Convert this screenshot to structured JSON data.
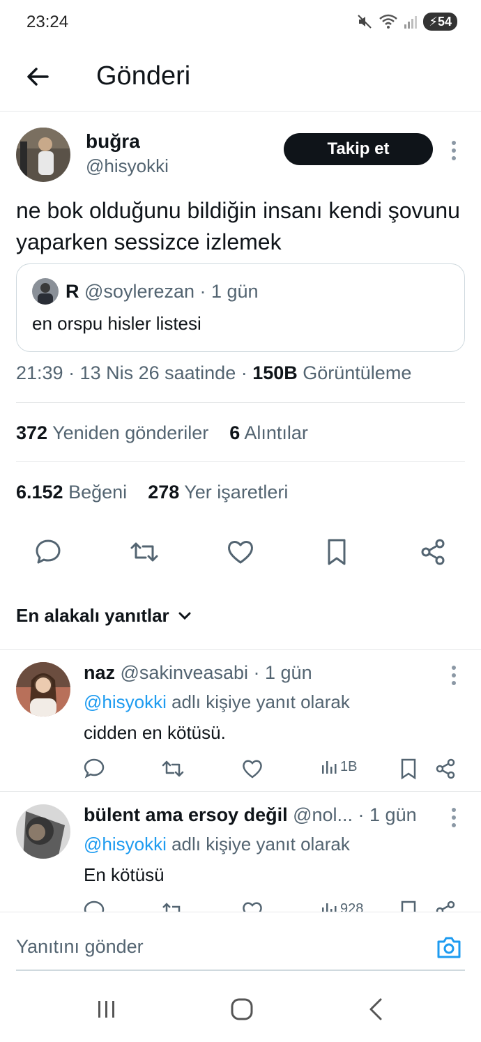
{
  "status": {
    "time": "23:24",
    "battery": "54"
  },
  "header": {
    "title": "Gönderi"
  },
  "author": {
    "name": "buğra",
    "handle": "@hisyokki",
    "follow_label": "Takip et"
  },
  "tweet": {
    "text": "ne bok olduğunu bildiğin insanı kendi şovunu yaparken sessizce izlemek",
    "quote": {
      "name": "R",
      "handle_time": "@soylerezan · 1 gün",
      "text": "en orspu hisler listesi"
    },
    "meta": {
      "time_date": "21:39 · 13 Nis 26 saatinde · ",
      "views_count": "150B",
      "views_label": " Görüntüleme"
    }
  },
  "stats": {
    "reposts_count": "372",
    "reposts_label": "Yeniden gönderiler",
    "quotes_count": "6",
    "quotes_label": "Alıntılar",
    "likes_count": "6.152",
    "likes_label": "Beğeni",
    "bookmarks_count": "278",
    "bookmarks_label": "Yer işaretleri"
  },
  "sort": {
    "label": "En alakalı yanıtlar"
  },
  "replies": [
    {
      "name": "naz",
      "handle_time": " @sakinveasabi · 1 gün",
      "mention": "@hisyokki",
      "replying_suffix": " adlı kişiye yanıt olarak",
      "text": "cidden en kötüsü.",
      "views": "1B"
    },
    {
      "name": "bülent ama ersoy değil",
      "handle_time": " @nol... · 1 gün",
      "mention": "@hisyokki",
      "replying_suffix": " adlı kişiye yanıt olarak",
      "text": "En kötüsü",
      "views": "928"
    }
  ],
  "compose": {
    "placeholder": "Yanıtını gönder"
  },
  "colors": {
    "accent": "#1d9bf0",
    "text": "#0f1419",
    "secondary": "#536471",
    "border": "#e7e9ea"
  }
}
